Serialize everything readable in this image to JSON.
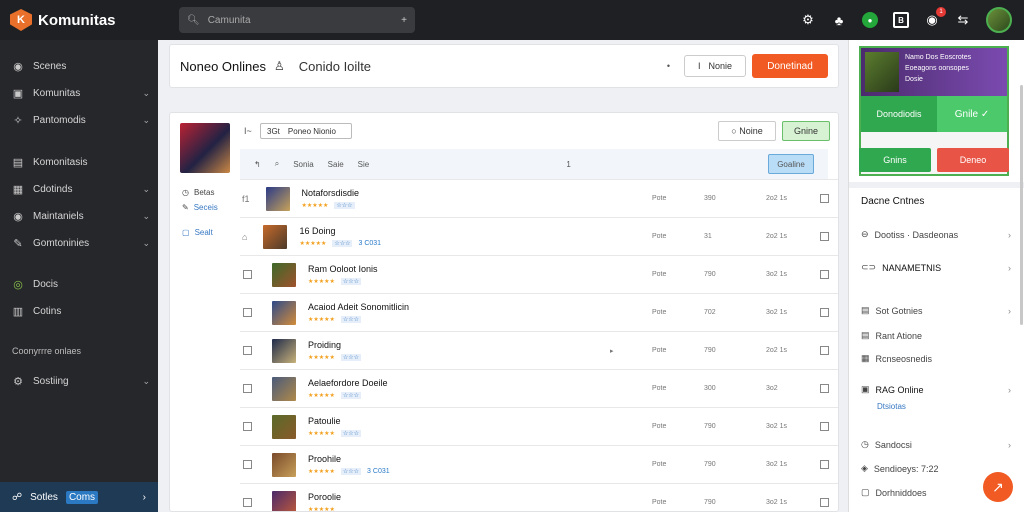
{
  "app": {
    "name": "Komunitas",
    "logo_letter": "K"
  },
  "search": {
    "placeholder": "Camunita"
  },
  "sidebar": {
    "items": [
      {
        "label": "Scenes"
      },
      {
        "label": "Komunitas"
      },
      {
        "label": "Pantomodis"
      },
      {
        "label": "Komonitasis"
      },
      {
        "label": "Cdotinds"
      },
      {
        "label": "Maintaniels"
      },
      {
        "label": "Gomtoninies"
      },
      {
        "label": "Docis"
      },
      {
        "label": "Cotins"
      },
      {
        "label": "Sostiing"
      }
    ],
    "section_label": "Coonyrrre onlaes",
    "bottom": {
      "label": "Sotles",
      "highlight": "Coms"
    }
  },
  "header": {
    "title": "Noneo Onlines",
    "subtitle": "Conido Ioilte",
    "filter_label": "Nonie",
    "filter_marker": "I",
    "action_label": "Donetinad"
  },
  "list": {
    "filter_text": "Poneo Nionio",
    "filter_prefix": "3Gt",
    "line_marker": "I~",
    "buttons": {
      "outline": "Noine",
      "green": "Gnine"
    },
    "subheader": {
      "a": "Sonia",
      "b": "Saie",
      "c": "Sie",
      "num": "1",
      "btn": "Goaline"
    },
    "left_nav": [
      "Betas",
      "Seceis",
      "Sealt"
    ],
    "rows": [
      {
        "title": "Notaforsdisdie",
        "stars": "★★★★★",
        "tag": "☆☆☆",
        "count": "",
        "c1": "Pote",
        "c2": "390",
        "c3": "2o2 1s"
      },
      {
        "title": "16 Doing",
        "stars": "★★★★★",
        "tag": "☆☆☆",
        "count": "3 C031",
        "c1": "Pote",
        "c2": "31",
        "c3": "2o2 1s"
      },
      {
        "title": "Ram Ooloot Ionis",
        "stars": "★★★★★",
        "tag": "☆☆☆",
        "count": "",
        "c1": "Pote",
        "c2": "790",
        "c3": "3o2 1s"
      },
      {
        "title": "Acaiod Adeit Sonomitlicin",
        "stars": "★★★★★",
        "tag": "☆☆☆",
        "count": "",
        "c1": "Pote",
        "c2": "702",
        "c3": "3o2 1s"
      },
      {
        "title": "Proiding",
        "stars": "★★★★★",
        "tag": "☆☆☆",
        "count": "",
        "c1": "Pote",
        "c2": "790",
        "c3": "2o2 1s"
      },
      {
        "title": "Aelaefordore Doeile",
        "stars": "★★★★★",
        "tag": "☆☆☆",
        "count": "",
        "c1": "Pote",
        "c2": "300",
        "c3": "3o2"
      },
      {
        "title": "Patoulie",
        "stars": "★★★★★",
        "tag": "☆☆☆",
        "count": "",
        "c1": "Pote",
        "c2": "790",
        "c3": "3o2 1s"
      },
      {
        "title": "Proohile",
        "stars": "★★★★★",
        "tag": "☆☆☆",
        "count": "3 C031",
        "c1": "Pote",
        "c2": "790",
        "c3": "3o2 1s"
      },
      {
        "title": "Poroolie",
        "stars": "★★★★★",
        "tag": "",
        "count": "",
        "c1": "Pote",
        "c2": "790",
        "c3": "3o2 1s"
      }
    ]
  },
  "right_panel": {
    "promo": {
      "line1": "Namo Dos Eoscrotes",
      "line2": "Eoeagons oonsopes",
      "line3": "Dosie",
      "left": "Donodiodis",
      "right": "Gnile"
    },
    "btn_green": "Gnins",
    "btn_red": "Deneo",
    "heading": "Dacne Cntnes",
    "items": [
      {
        "label": "Dootiss · Dasdeonas"
      },
      {
        "label": "NANAMETNIS"
      },
      {
        "label": "Sot Gotnies"
      },
      {
        "label": "Rant Atione"
      },
      {
        "label": "Rcnseosnedis"
      },
      {
        "label": "RAG Online"
      },
      {
        "label": "Sandocsi"
      },
      {
        "label": "Sendioeys: 7:22"
      },
      {
        "label": "Dorhniddoes"
      }
    ],
    "sub_blue": "Dtsiotas"
  },
  "colors": {
    "accent": "#f15a22",
    "green": "#2fa84f",
    "red": "#e85546",
    "sidebar": "#26272b"
  }
}
